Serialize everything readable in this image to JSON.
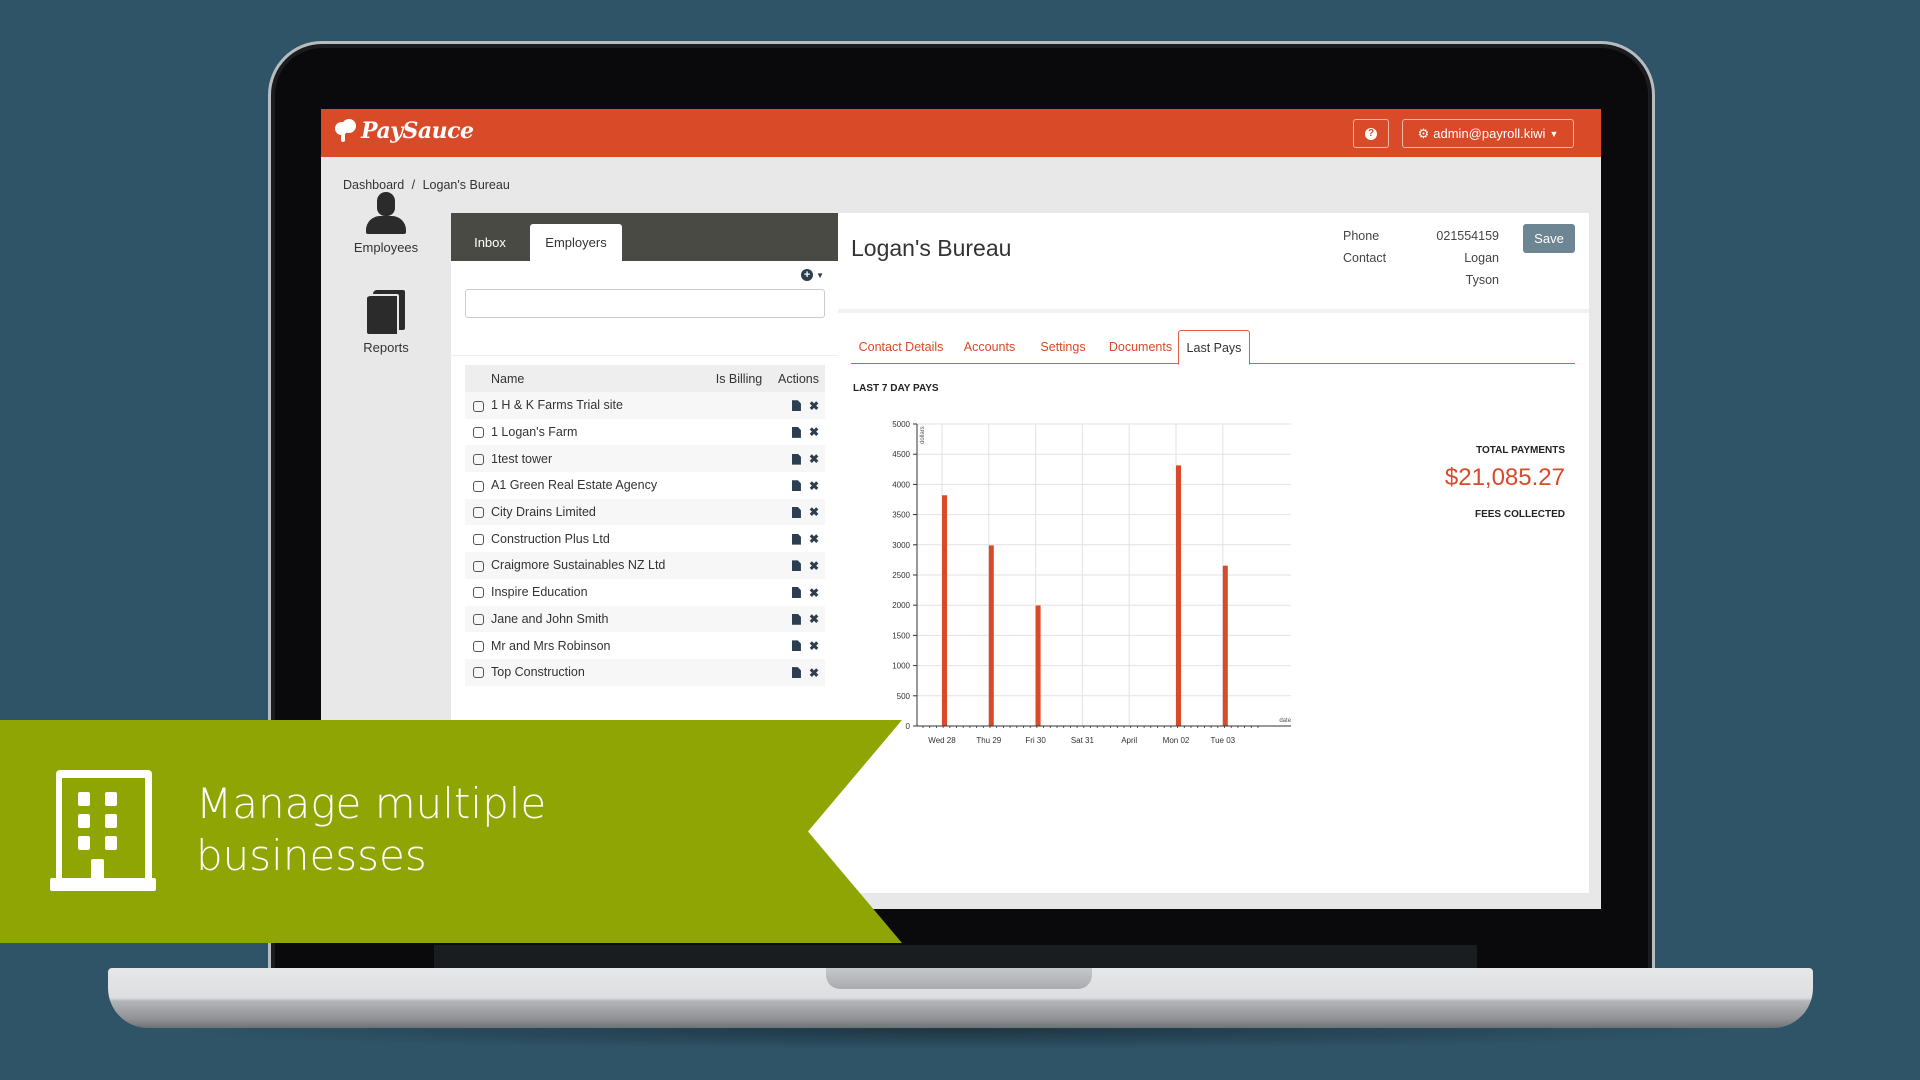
{
  "app": {
    "brand": "PaySauce",
    "help_label": "?",
    "user_menu": "admin@payroll.kiwi",
    "brand_color": "#d84a28",
    "accent_color": "#8ea504"
  },
  "breadcrumb": [
    "Dashboard",
    "/",
    "Logan's Bureau"
  ],
  "sidebar": {
    "items": [
      {
        "label": "Employees",
        "icon": "person-icon"
      },
      {
        "label": "Reports",
        "icon": "book-icon"
      }
    ]
  },
  "left_panel": {
    "tabs": [
      {
        "label": "Inbox",
        "active": false
      },
      {
        "label": "Employers",
        "active": true
      }
    ],
    "search_value": "",
    "add_icon": "plus-circle-icon",
    "table": {
      "headers": [
        "",
        "Name",
        "Is Billing",
        "Actions"
      ],
      "rows": [
        {
          "name": "1 H & K Farms Trial site"
        },
        {
          "name": "1 Logan's Farm"
        },
        {
          "name": "1test tower"
        },
        {
          "name": "A1 Green Real Estate Agency"
        },
        {
          "name": "City Drains Limited"
        },
        {
          "name": "Construction Plus Ltd"
        },
        {
          "name": "Craigmore Sustainables NZ Ltd"
        },
        {
          "name": "Inspire Education"
        },
        {
          "name": "Jane and John Smith"
        },
        {
          "name": "Mr and Mrs Robinson"
        },
        {
          "name": "Top Construction"
        }
      ]
    }
  },
  "detail": {
    "title": "Logan's Bureau",
    "phone_label": "Phone",
    "phone_value": "021554159",
    "contact_label": "Contact",
    "contact_value_1": "Logan",
    "contact_value_2": "Tyson",
    "save_label": "Save",
    "tabs": [
      {
        "label": "Contact Details",
        "active": false
      },
      {
        "label": "Accounts",
        "active": false
      },
      {
        "label": "Settings",
        "active": false
      },
      {
        "label": "Documents",
        "active": false
      },
      {
        "label": "Last Pays",
        "active": true
      }
    ],
    "chart_heading": "LAST 7 DAY PAYS",
    "total_payments_label": "TOTAL PAYMENTS",
    "total_payments_value": "$21,085.27",
    "fees_collected_label": "FEES COLLECTED"
  },
  "banner": {
    "line1": "Manage multiple",
    "line2": "businesses",
    "icon": "building-icon"
  },
  "chart_data": {
    "type": "bar",
    "title": "LAST 7 DAY PAYS",
    "categories": [
      "Wed 28",
      "Thu 29",
      "Fri 30",
      "Sat 31",
      "April",
      "Mon 02",
      "Tue 03"
    ],
    "values": [
      3820,
      2990,
      1995,
      0,
      0,
      4315,
      2655
    ],
    "xlabel": "date",
    "ylabel": "dollars",
    "ylim": [
      0,
      5000
    ],
    "yticks": [
      0,
      500,
      1000,
      1500,
      2000,
      2500,
      3000,
      3500,
      4000,
      4500,
      5000
    ],
    "grid": true,
    "bar_color": "#d84a28"
  }
}
